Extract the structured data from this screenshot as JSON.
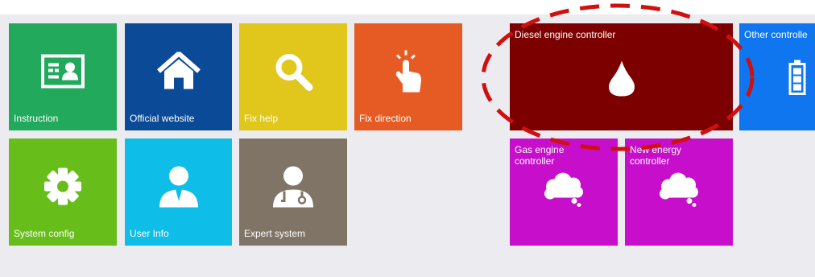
{
  "colors": {
    "background": "#ececf0",
    "instruction": "#22a95c",
    "official_website": "#0a4a97",
    "fix_help": "#e1c61b",
    "fix_direction": "#e65b24",
    "system_config": "#67be1b",
    "user_info": "#0ebde8",
    "expert_system": "#7f7466",
    "diesel_engine_controller": "#7c0000",
    "other_controller": "#0f76ef",
    "gas_engine_controller": "#c60ecb",
    "new_energy_controller": "#c60ecb",
    "highlight_circle": "#d01010"
  },
  "tiles": {
    "instruction": {
      "label": "Instruction",
      "icon": "id-card-icon"
    },
    "official_website": {
      "label": "Official website",
      "icon": "home-icon"
    },
    "fix_help": {
      "label": "Fix help",
      "icon": "search-icon"
    },
    "fix_direction": {
      "label": "Fix direction",
      "icon": "touch-hand-icon"
    },
    "system_config": {
      "label": "System config",
      "icon": "gear-icon"
    },
    "user_info": {
      "label": "User Info",
      "icon": "user-icon"
    },
    "expert_system": {
      "label": "Expert system",
      "icon": "doctor-icon"
    },
    "diesel_engine_controller": {
      "label": "Diesel engine controller",
      "icon": "droplet-icon"
    },
    "other_controller": {
      "label": "Other controlle",
      "icon": "battery-icon"
    },
    "gas_engine_controller": {
      "label": "Gas engine controller",
      "icon": "cloud-icon"
    },
    "new_energy_controller": {
      "label": "New energy controller",
      "icon": "cloud-icon"
    }
  }
}
